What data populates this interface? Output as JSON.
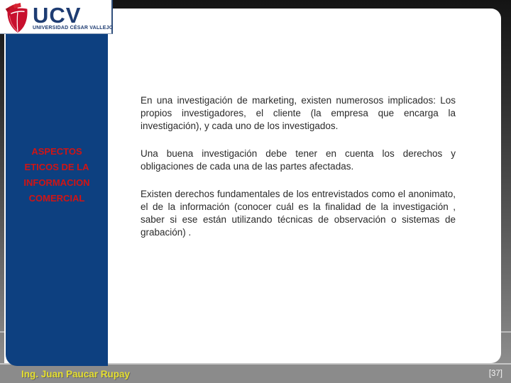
{
  "logo": {
    "acronym": "UCV",
    "university_name": "UNIVERSIDAD CÉSAR VALLEJO",
    "shield_icon": "ucv-shield-icon"
  },
  "sidebar": {
    "title": "ASPECTOS ETICOS DE LA INFORMACION COMERCIAL"
  },
  "content": {
    "paragraphs": [
      "En una investigación de marketing, existen numerosos implicados: Los propios investigadores, el cliente (la empresa que encarga la investigación), y cada uno de los investigados.",
      "Una buena investigación debe tener en cuenta los derechos y obligaciones de cada una de las partes afectadas.",
      "Existen derechos fundamentales de los entrevistados como el anonimato, el de la información (conocer cuál es la finalidad de la investigación , saber si ese están utilizando técnicas de observación o sistemas de grabación) ."
    ]
  },
  "footer": {
    "author": "Ing. Juan Paucar Rupay",
    "page_number": "[37]"
  },
  "colors": {
    "sidebar_blue": "#0d4080",
    "title_red": "#d11414",
    "body_text": "#2a2a2a",
    "footer_gray": "#8b8b8b",
    "footer_yellow": "#e5df2f",
    "logo_navy": "#1e3c72",
    "shield_red": "#c8102e",
    "frame_top": "#141414",
    "frame_bottom": "#8d8d8d"
  }
}
